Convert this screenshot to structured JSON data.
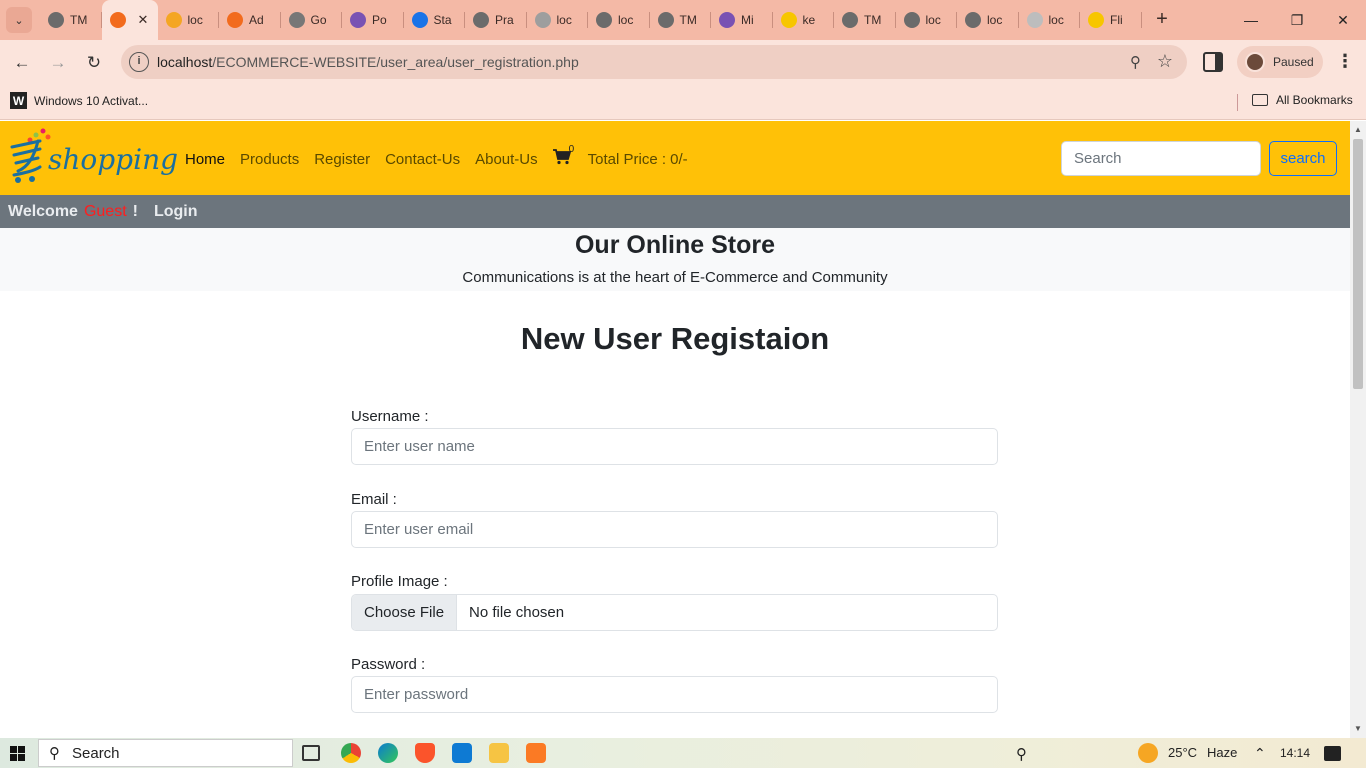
{
  "browser": {
    "tabs": [
      {
        "label": "TM",
        "icon": "globe-icon",
        "color": "#6b6b6b"
      },
      {
        "label": "",
        "icon": "xampp-icon",
        "color": "#f26b1d",
        "active": true
      },
      {
        "label": "loc",
        "icon": "phpmyadmin-icon",
        "color": "#f4a623"
      },
      {
        "label": "Ad",
        "icon": "xampp-icon",
        "color": "#f26b1d"
      },
      {
        "label": "Go",
        "icon": "gear-icon",
        "color": "#777777"
      },
      {
        "label": "Po",
        "icon": "bootstrap-icon",
        "color": "#7952b3"
      },
      {
        "label": "Sta",
        "icon": "bolt-icon",
        "color": "#1a73e8"
      },
      {
        "label": "Pra",
        "icon": "globe-icon",
        "color": "#6b6b6b"
      },
      {
        "label": "loc",
        "icon": "user-icon",
        "color": "#9e9e9e"
      },
      {
        "label": "loc",
        "icon": "globe-icon",
        "color": "#6b6b6b"
      },
      {
        "label": "TM",
        "icon": "globe-icon",
        "color": "#6b6b6b"
      },
      {
        "label": "Mi",
        "icon": "bootstrap-icon",
        "color": "#7952b3"
      },
      {
        "label": "ke",
        "icon": "bulb-icon",
        "color": "#f7c600"
      },
      {
        "label": "TM",
        "icon": "globe-icon",
        "color": "#6b6b6b"
      },
      {
        "label": "loc",
        "icon": "globe-icon",
        "color": "#6b6b6b"
      },
      {
        "label": "loc",
        "icon": "globe-icon",
        "color": "#6b6b6b"
      },
      {
        "label": "loc",
        "icon": "page-icon",
        "color": "#bdbdbd"
      },
      {
        "label": "Fli",
        "icon": "flipkart-icon",
        "color": "#f7c600"
      }
    ],
    "url_host": "localhost",
    "url_path": "/ECOMMERCE-WEBSITE/user_area/user_registration.php",
    "profile_status": "Paused",
    "bookmark": "Windows 10 Activat...",
    "all_bookmarks": "All Bookmarks"
  },
  "site": {
    "logo_text": "shopping",
    "nav": {
      "home": "Home",
      "products": "Products",
      "register": "Register",
      "contact": "Contact-Us",
      "about": "About-Us",
      "cart_count": "0",
      "total_price": "Total Price : 0/-"
    },
    "search_placeholder": "Search",
    "search_button": "search",
    "welcome": "Welcome",
    "guest": "Guest",
    "exclaim": "!",
    "login": "Login",
    "hero_title": "Our Online Store",
    "hero_subtitle": "Communications is at the heart of E-Commerce and Community"
  },
  "form": {
    "title": "New User Registaion",
    "username_label": "Username :",
    "username_placeholder": "Enter user name",
    "email_label": "Email :",
    "email_placeholder": "Enter user email",
    "image_label": "Profile Image :",
    "file_button": "Choose File",
    "file_status": "No file chosen",
    "password_label": "Password :",
    "password_placeholder": "Enter password"
  },
  "taskbar": {
    "search": "Search",
    "temperature": "25°C",
    "weather": "Haze",
    "time": "14:14"
  },
  "colors": {
    "navbar": "#ffc107",
    "welcome_bar": "#6c757d",
    "guest": "#ff1e1e",
    "primary": "#0d6efd"
  }
}
